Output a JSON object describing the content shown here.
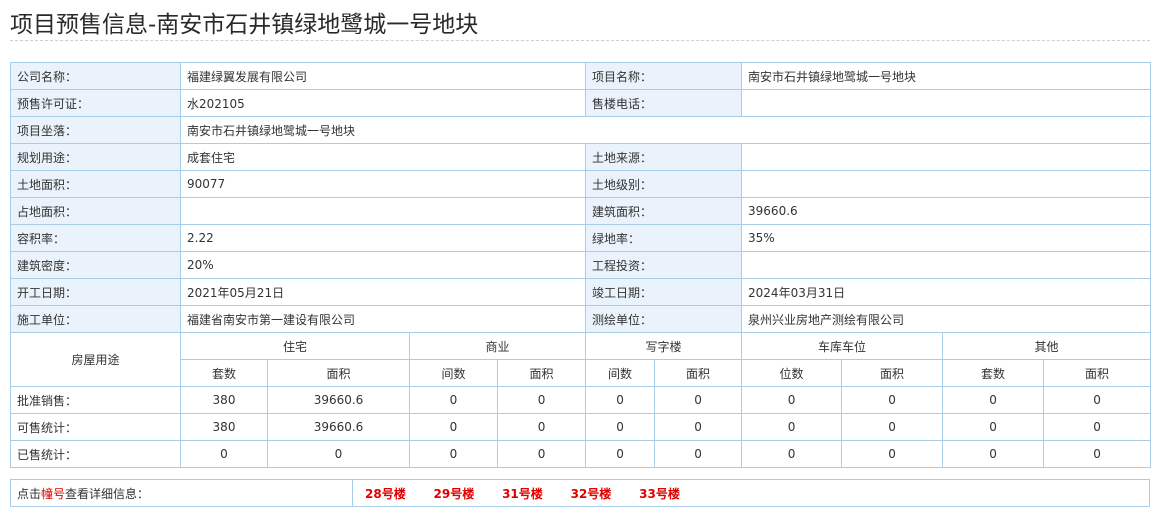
{
  "page": {
    "title": "项目预售信息-南安市石井镇绿地鹭城一号地块"
  },
  "info": {
    "company_label": "公司名称：",
    "company": "福建绿翼发展有限公司",
    "project_label": "项目名称：",
    "project": "南安市石井镇绿地鹭城一号地块",
    "permit_label": "预售许可证：",
    "permit": "水202105",
    "phone_label": "售楼电话：",
    "phone": "",
    "location_label": "项目坐落：",
    "location": "南安市石井镇绿地鹭城一号地块",
    "planning_label": "规划用途：",
    "planning": "成套住宅",
    "land_source_label": "土地来源：",
    "land_source": "",
    "land_area_label": "土地面积：",
    "land_area": "90077",
    "land_grade_label": "土地级别：",
    "land_grade": "",
    "occupied_label": "占地面积：",
    "occupied": "",
    "building_area_label": "建筑面积：",
    "building_area": "39660.6",
    "far_label": "容积率：",
    "far": "2.22",
    "green_label": "绿地率：",
    "green": "35%",
    "density_label": "建筑密度：",
    "density": "20%",
    "investment_label": "工程投资：",
    "investment": "",
    "start_label": "开工日期：",
    "start": "2021年05月21日",
    "finish_label": "竣工日期：",
    "finish": "2024年03月31日",
    "builder_label": "施工单位：",
    "builder": "福建省南安市第一建设有限公司",
    "surveyor_label": "测绘单位：",
    "surveyor": "泉州兴业房地产测绘有限公司"
  },
  "stats": {
    "usage_label": "房屋用途",
    "groups": [
      "住宅",
      "商业",
      "写字楼",
      "车库车位",
      "其他"
    ],
    "subheads": [
      "套数",
      "面积",
      "间数",
      "面积",
      "间数",
      "面积",
      "位数",
      "面积",
      "套数",
      "面积"
    ],
    "rows": [
      {
        "label": "批准销售：",
        "cells": [
          "380",
          "39660.6",
          "0",
          "0",
          "0",
          "0",
          "0",
          "0",
          "0",
          "0"
        ]
      },
      {
        "label": "可售统计：",
        "cells": [
          "380",
          "39660.6",
          "0",
          "0",
          "0",
          "0",
          "0",
          "0",
          "0",
          "0"
        ]
      },
      {
        "label": "已售统计：",
        "cells": [
          "0",
          "0",
          "0",
          "0",
          "0",
          "0",
          "0",
          "0",
          "0",
          "0"
        ]
      }
    ]
  },
  "footer": {
    "prefix": "点击",
    "highlight": "幢号",
    "suffix": "查看详细信息：",
    "buildings": [
      "28号楼",
      "29号楼",
      "31号楼",
      "32号楼",
      "33号楼"
    ]
  },
  "colors": {
    "border": "#a9cde6",
    "label_bg": "#eaf3fb",
    "link": "#e00000"
  }
}
